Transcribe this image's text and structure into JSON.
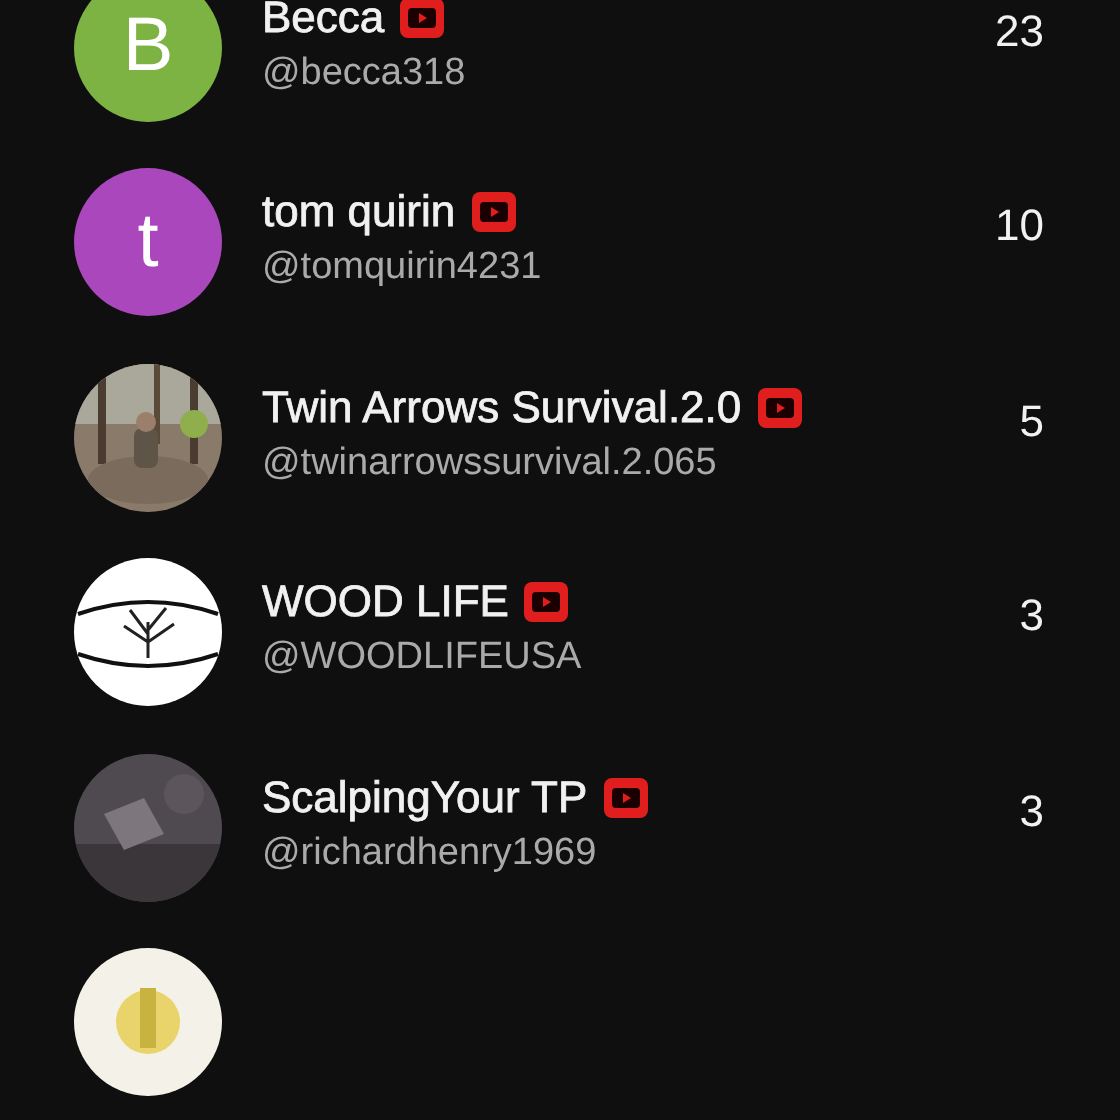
{
  "channels": [
    {
      "avatar": {
        "kind": "letter",
        "letter": "B",
        "color": "#7cb342"
      },
      "name": "Becca",
      "handle": "@becca318",
      "count": "23"
    },
    {
      "avatar": {
        "kind": "letter",
        "letter": "t",
        "color": "#ab47bc"
      },
      "name": "tom quirin",
      "handle": "@tomquirin4231",
      "count": "10"
    },
    {
      "avatar": {
        "kind": "picture"
      },
      "name": "Twin Arrows Survival.2.0",
      "handle": "@twinarrowssurvival.2.065",
      "count": "5"
    },
    {
      "avatar": {
        "kind": "picture"
      },
      "name": "WOOD LIFE",
      "handle": "@WOODLIFEUSA",
      "count": "3"
    },
    {
      "avatar": {
        "kind": "picture"
      },
      "name": "ScalpingYour TP",
      "handle": "@richardhenry1969",
      "count": "3"
    },
    {
      "avatar": {
        "kind": "picture"
      }
    }
  ]
}
